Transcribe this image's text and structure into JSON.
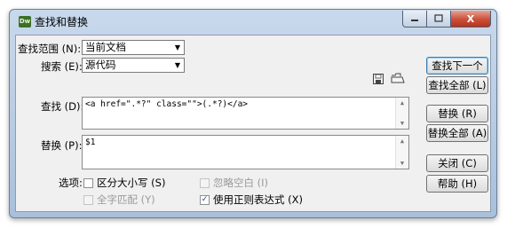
{
  "window": {
    "title": "查找和替换",
    "app_icon_text": "Dw",
    "close_glyph": "X"
  },
  "form": {
    "scope_label": "查找范围 (N):",
    "scope_value": "当前文档",
    "search_label": "搜索 (E):",
    "search_value": "源代码",
    "find_label": "查找 (D):",
    "find_value": "<a href=\".*?\" class=\"\">(.*?)</a>",
    "replace_label": "替换 (P):",
    "replace_value": "$1",
    "options_label": "选项:"
  },
  "options": {
    "match_case": {
      "label": "区分大小写 (S)",
      "checked": false,
      "enabled": true
    },
    "ignore_whitespace": {
      "label": "忽略空白 (I)",
      "checked": false,
      "enabled": false
    },
    "whole_word": {
      "label": "全字匹配 (Y)",
      "checked": false,
      "enabled": false
    },
    "use_regex": {
      "label": "使用正则表达式 (X)",
      "checked": true,
      "enabled": true
    }
  },
  "buttons": {
    "find_next": "查找下一个 (F)",
    "find_all": "查找全部 (L)",
    "replace": "替换 (R)",
    "replace_all": "替换全部 (A)",
    "close": "关闭 (C)",
    "help": "帮助 (H)"
  },
  "icons": {
    "save_query": "save-icon",
    "load_query": "open-folder-icon"
  }
}
